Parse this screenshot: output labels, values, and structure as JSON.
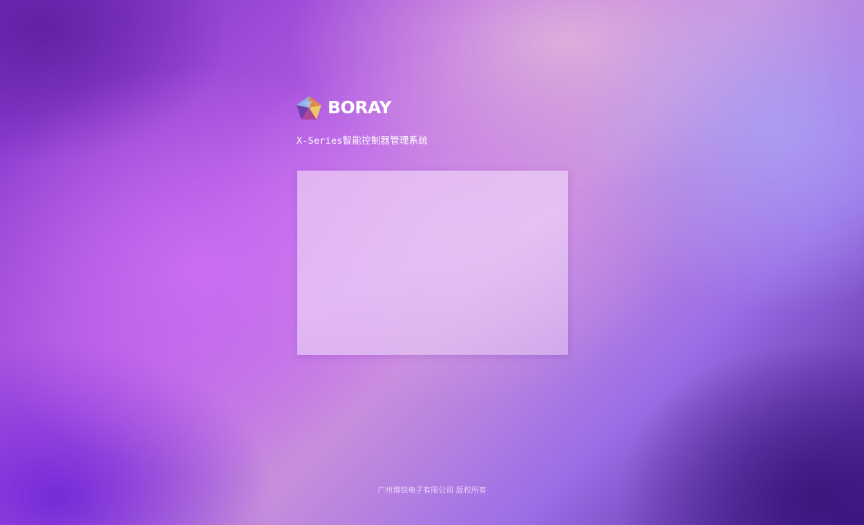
{
  "brand": {
    "logo_text": "BORAY",
    "icon": "pentagon-logo-icon"
  },
  "subtitle": "X-Series智能控制器管理系统",
  "login_panel": {
    "contents": []
  },
  "footer": {
    "copyright": "广州博锐电子有限公司 版权所有"
  },
  "colors": {
    "background_top_left": "#5a1e9a",
    "background_center_left": "#c96ef2",
    "background_top_right": "#c9a8dc",
    "background_bottom_right": "#3b157a",
    "text": "#ffffff",
    "panel": "#e6c8f2"
  }
}
